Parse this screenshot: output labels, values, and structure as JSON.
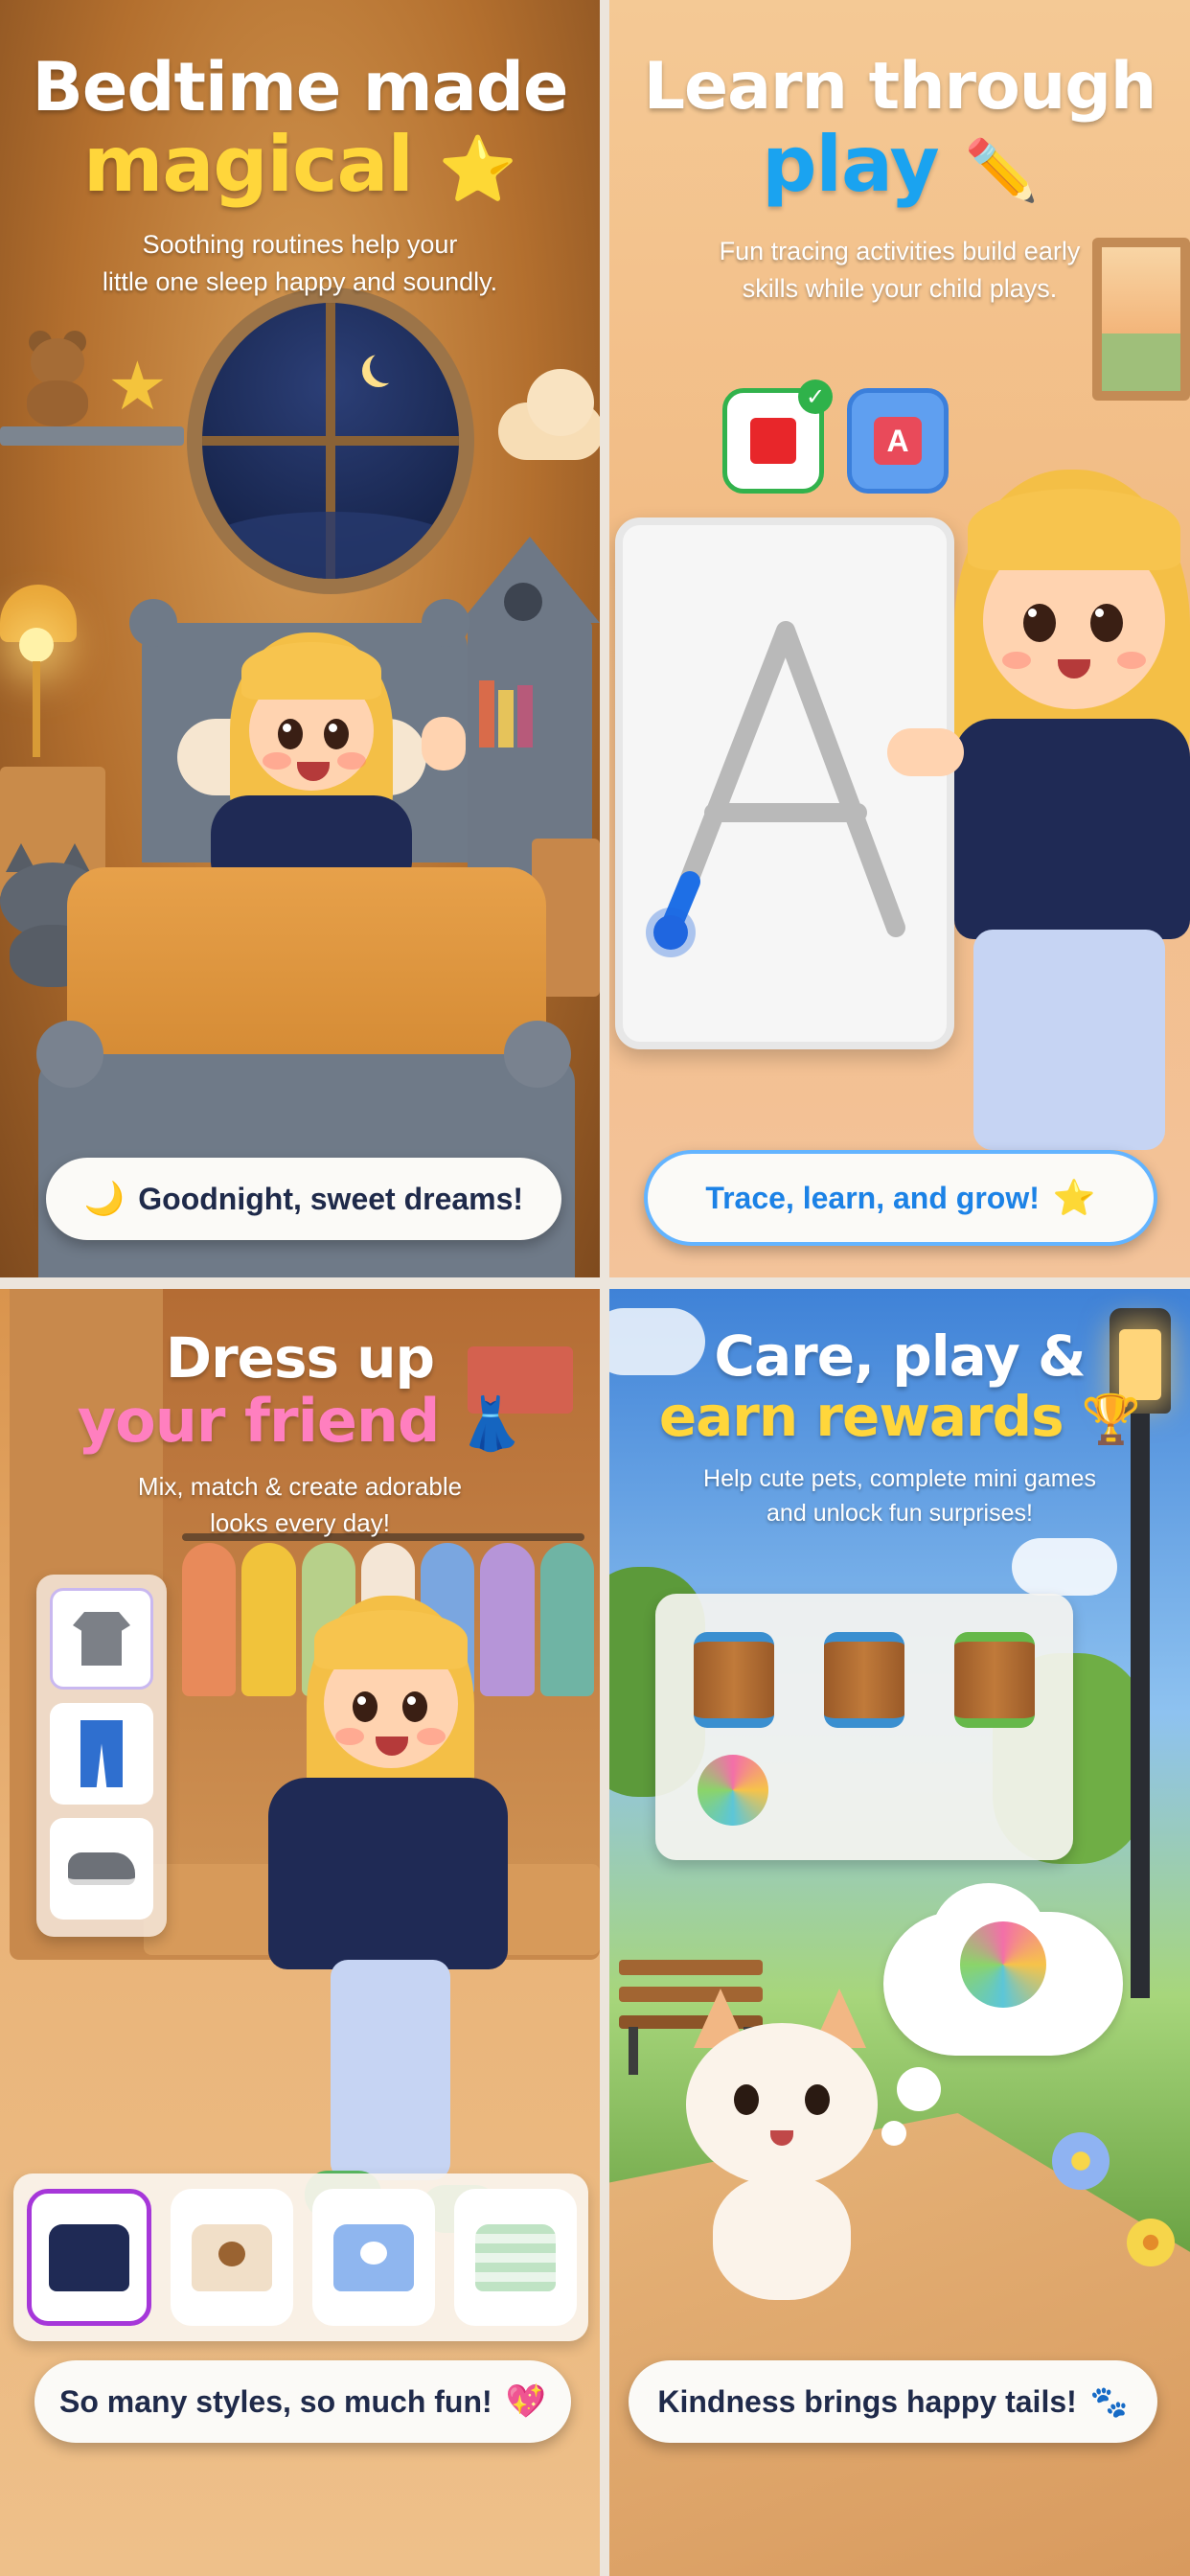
{
  "panels": [
    {
      "title_line1": "Bedtime made",
      "title_line2": "magical",
      "title_emoji": "⭐",
      "subtitle_line1": "Soothing routines help your",
      "subtitle_line2": "little one sleep happy and soundly.",
      "pill_icon": "🌙",
      "pill_text": "Goodnight, sweet dreams!"
    },
    {
      "title_line1": "Learn through",
      "title_line2": "play",
      "title_emoji": "✏️",
      "subtitle_line1": "Fun tracing activities build early",
      "subtitle_line2": "skills while your child plays.",
      "tracing_letter": "A",
      "option_letter": "A",
      "pill_text": "Trace, learn, and grow!",
      "pill_icon": "⭐"
    },
    {
      "title_line1": "Dress up",
      "title_line2": "your friend",
      "title_emoji": "👗",
      "subtitle_line1": "Mix, match & create adorable",
      "subtitle_line2": "looks every day!",
      "side_items": [
        "t-shirt-icon",
        "jeans-icon",
        "sneaker-icon"
      ],
      "outfits": [
        "navy-star-sweater",
        "bear-sweater",
        "bunny-sweater",
        "striped-sweater"
      ],
      "pill_text": "So many styles, so much fun!",
      "pill_icon": "💖"
    },
    {
      "title_line1": "Care, play &",
      "title_line2": "earn rewards",
      "title_emoji": "🏆",
      "subtitle_line1": "Help cute pets, complete mini games",
      "subtitle_line2": "and unlock fun surprises!",
      "game_items": [
        "barrel-blue-icon",
        "barrel-blue-icon",
        "barrel-green-icon",
        "yarn-ball-icon"
      ],
      "pill_text": "Kindness brings happy tails!",
      "pill_icon": "🐾"
    }
  ],
  "colors": {
    "title_yellow": "#ffd63b",
    "title_blue": "#1aa3f0",
    "title_pink": "#ff7fbf",
    "pill_blue": "#1c82e6",
    "selected_outfit": "#a637d9"
  }
}
